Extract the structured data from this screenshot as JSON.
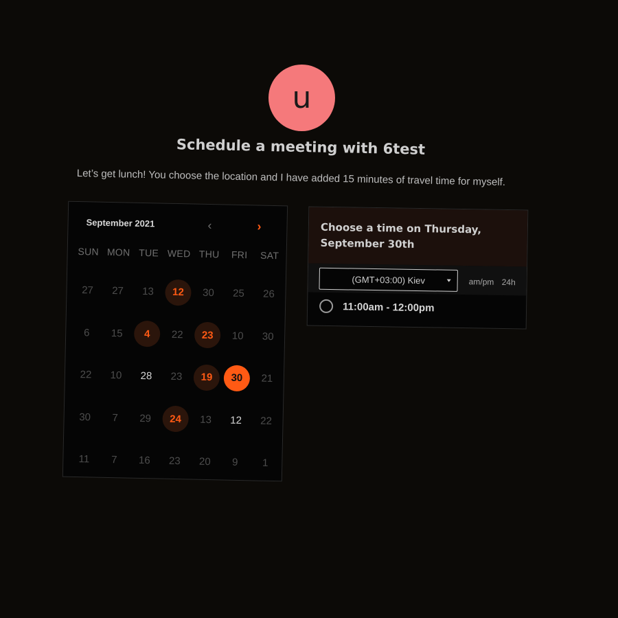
{
  "avatar": {
    "initial": "u",
    "color": "#f5797b"
  },
  "title": "Schedule a meeting with 6test",
  "subtitle": "Let’s get lunch! You choose the location and I have added 15 minutes of travel time for myself.",
  "calendar": {
    "month_label": "September 2021",
    "prev_icon": "‹",
    "next_icon": "›",
    "weekdays": [
      "SUN",
      "MON",
      "TUE",
      "WED",
      "THU",
      "FRI",
      "SAT"
    ],
    "weeks": [
      [
        {
          "d": "27",
          "s": "dim"
        },
        {
          "d": "27",
          "s": "dim"
        },
        {
          "d": "13",
          "s": "dim"
        },
        {
          "d": "12",
          "s": "avail"
        },
        {
          "d": "30",
          "s": "dim"
        },
        {
          "d": "25",
          "s": "dim"
        },
        {
          "d": "26",
          "s": "dim"
        }
      ],
      [
        {
          "d": "6",
          "s": "dim"
        },
        {
          "d": "15",
          "s": "dim"
        },
        {
          "d": "4",
          "s": "avail"
        },
        {
          "d": "22",
          "s": "dim"
        },
        {
          "d": "23",
          "s": "avail"
        },
        {
          "d": "10",
          "s": "dim"
        },
        {
          "d": "30",
          "s": "dim"
        }
      ],
      [
        {
          "d": "22",
          "s": "dim"
        },
        {
          "d": "10",
          "s": "dim"
        },
        {
          "d": "28",
          "s": "normal"
        },
        {
          "d": "23",
          "s": "dim"
        },
        {
          "d": "19",
          "s": "avail"
        },
        {
          "d": "30",
          "s": "selected"
        },
        {
          "d": "21",
          "s": "dim"
        }
      ],
      [
        {
          "d": "30",
          "s": "dim"
        },
        {
          "d": "7",
          "s": "dim"
        },
        {
          "d": "29",
          "s": "dim"
        },
        {
          "d": "24",
          "s": "avail"
        },
        {
          "d": "13",
          "s": "dim"
        },
        {
          "d": "12",
          "s": "normal"
        },
        {
          "d": "22",
          "s": "dim"
        }
      ],
      [
        {
          "d": "11",
          "s": "dim"
        },
        {
          "d": "7",
          "s": "dim"
        },
        {
          "d": "16",
          "s": "dim"
        },
        {
          "d": "23",
          "s": "dim"
        },
        {
          "d": "20",
          "s": "dim"
        },
        {
          "d": "9",
          "s": "dim"
        },
        {
          "d": "1",
          "s": "dim"
        }
      ]
    ],
    "accent_color": "#ff5a14"
  },
  "time_panel": {
    "title": "Choose a time on Thursday, September 30th",
    "timezone": "(GMT+03:00) Kiev",
    "format_ampm": "am/pm",
    "format_24": "24h",
    "slots": [
      "11:00am - 12:00pm"
    ]
  }
}
